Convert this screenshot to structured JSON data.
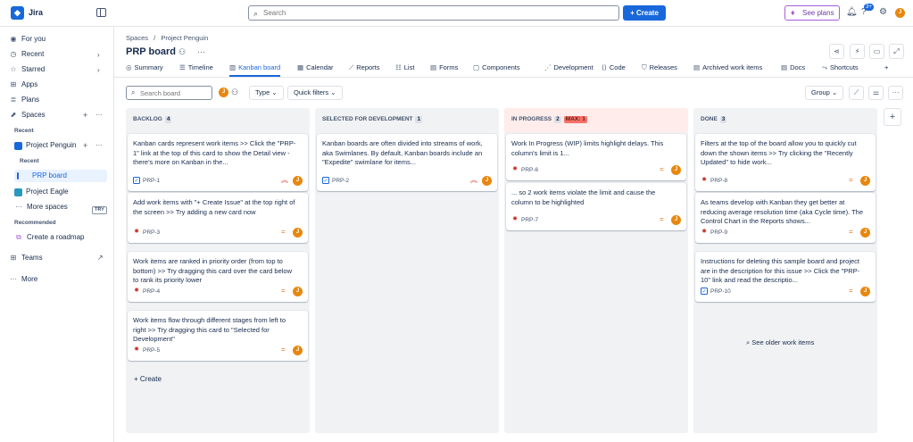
{
  "app": {
    "name": "Jira"
  },
  "topbar": {
    "search_placeholder": "Search",
    "create_label": "Create",
    "plans_label": "See plans",
    "notification_badge": "3+",
    "avatar_initial": "J"
  },
  "sidebar": {
    "for_you": "For you",
    "recent": "Recent",
    "starred": "Starred",
    "apps": "Apps",
    "plans": "Plans",
    "spaces": "Spaces",
    "recent_section": "Recent",
    "project_penguin": "Project Penguin",
    "recent_sub": "Recent",
    "prp_board": "PRP board",
    "project_eagle": "Project Eagle",
    "more_spaces": "More spaces",
    "recommended": "Recommended",
    "create_roadmap": "Create a roadmap",
    "try_badge": "TRY",
    "teams": "Teams",
    "more": "More"
  },
  "header": {
    "breadcrumb_spaces": "Spaces",
    "breadcrumb_sep": "/",
    "breadcrumb_project": "Project Penguin",
    "title": "PRP board"
  },
  "tabs": [
    "Summary",
    "Timeline",
    "Kanban board",
    "Calendar",
    "Reports",
    "List",
    "Forms",
    "Components",
    "Development",
    "Code",
    "Releases",
    "Archived work items",
    "Docs",
    "Shortcuts"
  ],
  "toolbar": {
    "search_placeholder": "Search board",
    "type_label": "Type",
    "quick_filters_label": "Quick filters",
    "group_label": "Group"
  },
  "columns": [
    {
      "name": "BACKLOG",
      "count": "4",
      "cards": [
        {
          "text": "Kanban cards represent work items >> Click the \"PRP-1\" link at the top of this card to show the Detail view - there's more on Kanban in the...",
          "key": "PRP-1",
          "type": "task",
          "priority": "high"
        },
        {
          "text": "Add work items with \"+ Create Issue\" at the top right of the screen >> Try adding a new card now",
          "key": "PRP-3",
          "type": "bug",
          "priority": "medium"
        },
        {
          "text": "Work items are ranked in priority order (from top to bottom) >> Try dragging this card over the card below to rank its priority lower",
          "key": "PRP-4",
          "type": "bug",
          "priority": "medium"
        },
        {
          "text": "Work items flow through different stages from left to right >> Try dragging this card to \"Selected for Development\"",
          "key": "PRP-5",
          "type": "bug",
          "priority": "medium"
        }
      ]
    },
    {
      "name": "SELECTED FOR DEVELOPMENT",
      "count": "1",
      "cards": [
        {
          "text": "Kanban boards are often divided into streams of work, aka Swimlanes. By default, Kanban boards include an \"Expedite\" swimlane for items...",
          "key": "PRP-2",
          "type": "task",
          "priority": "high"
        }
      ]
    },
    {
      "name": "IN PROGRESS",
      "count": "2",
      "max": "MAX: 1",
      "cards": [
        {
          "text": "Work In Progress (WIP) limits highlight delays. This column's limit is 1...",
          "key": "PRP-6",
          "type": "bug",
          "priority": "medium"
        },
        {
          "text": "... so 2 work items violate the limit and cause the column to be highlighted",
          "key": "PRP-7",
          "type": "bug",
          "priority": "medium"
        }
      ]
    },
    {
      "name": "DONE",
      "count": "3",
      "cards": [
        {
          "text": "Filters at the top of the board allow you to quickly cut down the shown items >> Try clicking the \"Recently Updated\" to hide work...",
          "key": "PRP-8",
          "type": "bug",
          "priority": "medium"
        },
        {
          "text": "As teams develop with Kanban they get better at reducing average resolution time (aka Cycle time). The Control Chart in the Reports shows...",
          "key": "PRP-9",
          "type": "bug",
          "priority": "medium"
        },
        {
          "text": "Instructions for deleting this sample board and project are in the description for this issue >> Click the \"PRP-10\" link and read the descriptio...",
          "key": "PRP-10",
          "type": "task",
          "priority": "medium"
        }
      ]
    }
  ],
  "create_label": "+ Create",
  "older_label": "See older work items",
  "colors": {
    "accent": "#1868db",
    "avatar": "#e8870e",
    "warn_bg": "#ffeceb"
  }
}
